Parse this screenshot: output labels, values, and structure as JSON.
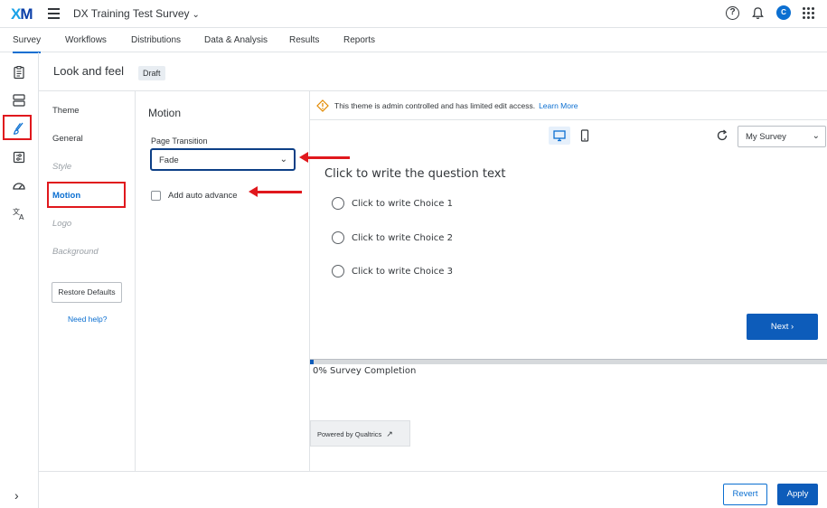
{
  "app": {
    "logo": {
      "x": "X",
      "m": "M"
    },
    "survey_title": "DX Training Test Survey",
    "avatar_initial": "C",
    "help_glyph": "?"
  },
  "nav": {
    "tabs": [
      "Survey",
      "Workflows",
      "Distributions",
      "Data & Analysis",
      "Results",
      "Reports"
    ],
    "active_tab": "Survey"
  },
  "left_rail": {
    "icons": [
      "survey-clipboard-icon",
      "survey-flow-icon",
      "look-and-feel-brush-icon",
      "survey-options-icon",
      "dashboard-gauge-icon",
      "translate-icon"
    ],
    "active": "look-and-feel-brush-icon",
    "expand_glyph": "›"
  },
  "header": {
    "title": "Look and feel",
    "badge": "Draft"
  },
  "settings_nav": {
    "items": [
      {
        "label": "Theme",
        "state": "normal"
      },
      {
        "label": "General",
        "state": "normal"
      },
      {
        "label": "Style",
        "state": "disabled"
      },
      {
        "label": "Motion",
        "state": "selected"
      },
      {
        "label": "Logo",
        "state": "disabled"
      },
      {
        "label": "Background",
        "state": "disabled"
      }
    ],
    "restore_defaults": "Restore Defaults",
    "need_help": "Need help?"
  },
  "motion_panel": {
    "title": "Motion",
    "page_transition_label": "Page Transition",
    "page_transition_value": "Fade",
    "auto_advance_label": "Add auto advance",
    "auto_advance_checked": false
  },
  "preview": {
    "notice": "This theme is admin controlled and has limited edit access.",
    "learn_more": "Learn More",
    "view_mode": "desktop",
    "survey_select_value": "My Survey",
    "question": "Click to write the question text",
    "choices": [
      "Click to write Choice 1",
      "Click to write Choice 2",
      "Click to write Choice 3"
    ],
    "next_label": "Next  ›",
    "progress_percent": 0,
    "progress_label": "0%  Survey Completion",
    "powered_by": "Powered by Qualtrics"
  },
  "footer": {
    "revert": "Revert",
    "apply": "Apply"
  },
  "colors": {
    "accent": "#0b6fd1",
    "primary_button": "#0d5cba",
    "annotation_red": "#e0181d"
  }
}
